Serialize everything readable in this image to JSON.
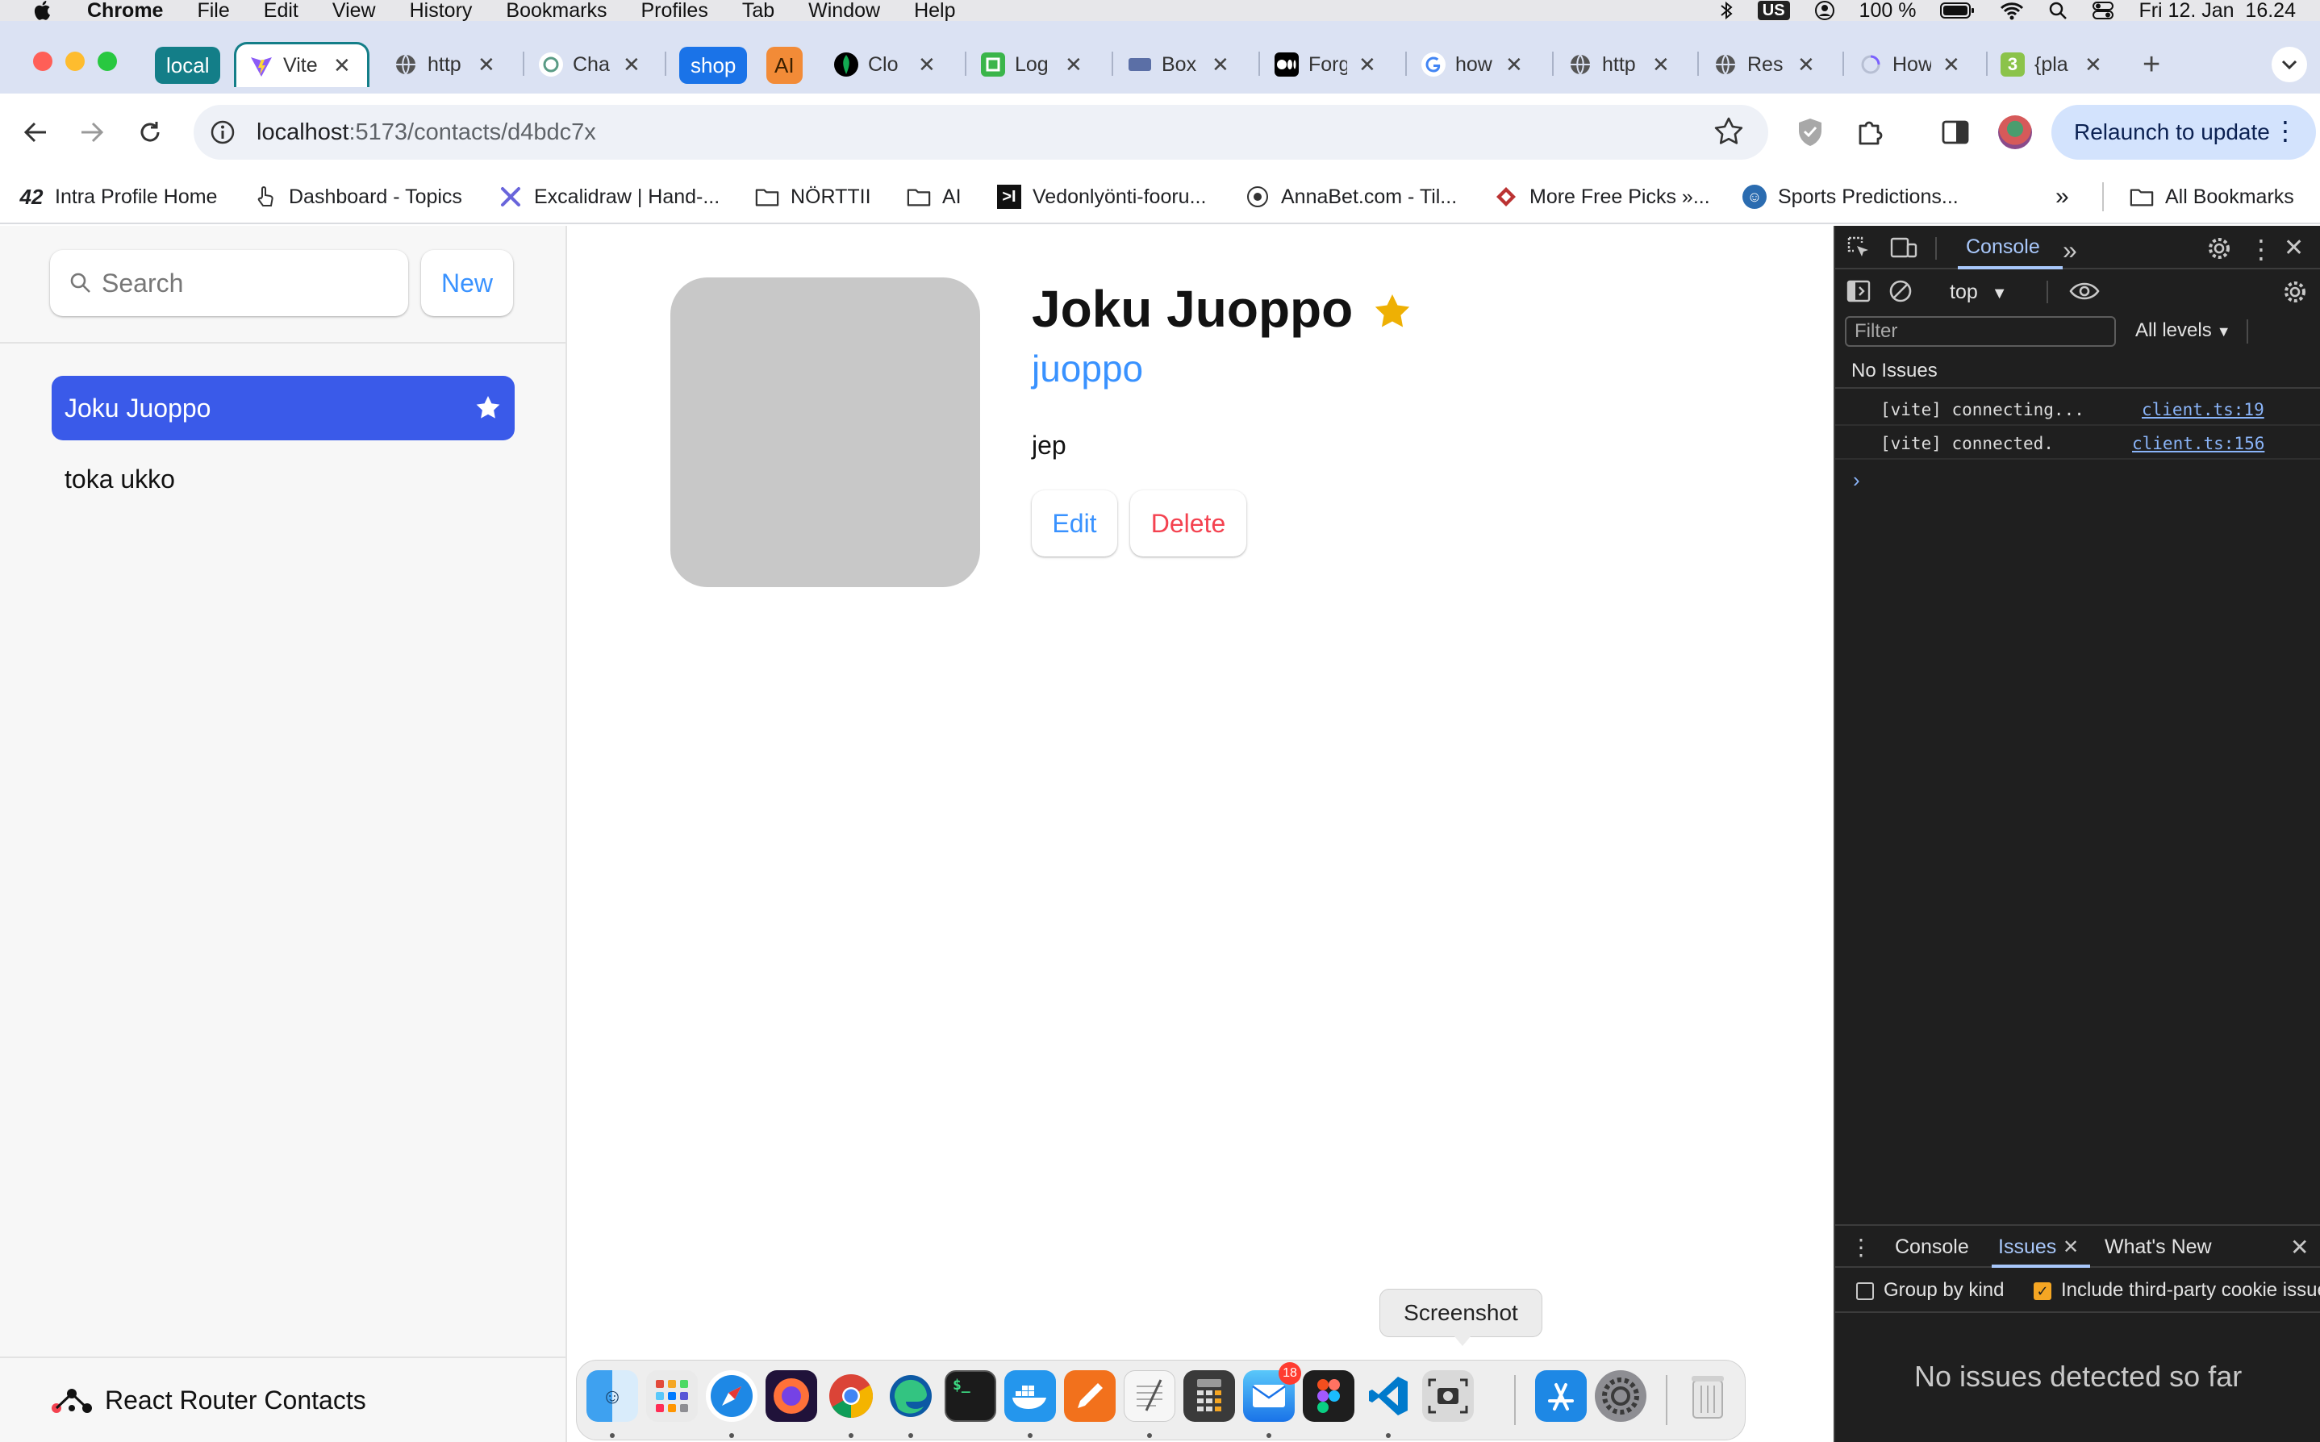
{
  "menubar": {
    "app_name": "Chrome",
    "items": [
      "File",
      "Edit",
      "View",
      "History",
      "Bookmarks",
      "Profiles",
      "Tab",
      "Window",
      "Help"
    ],
    "input_source": "US",
    "battery": "100 %",
    "datetime": "Fri 12. Jan  16.24"
  },
  "tabs": {
    "group_local": "local",
    "group_shop": "shop",
    "group_ai": "AI",
    "items": [
      {
        "title": "Vite",
        "icon": "vite-icon"
      },
      {
        "title": "http",
        "icon": "globe-icon"
      },
      {
        "title": "Cha",
        "icon": "chatgpt-icon"
      },
      {
        "title": "Clo",
        "icon": "mongodb-icon"
      },
      {
        "title": "Log",
        "icon": "log-icon"
      },
      {
        "title": "Box",
        "icon": "box-icon"
      },
      {
        "title": "Forg",
        "icon": "medium-icon"
      },
      {
        "title": "how",
        "icon": "google-icon"
      },
      {
        "title": "http",
        "icon": "globe-icon"
      },
      {
        "title": "Res",
        "icon": "globe-icon"
      },
      {
        "title": "How",
        "icon": "spinner-icon"
      },
      {
        "title": "{pla",
        "icon": "code-icon"
      }
    ]
  },
  "toolbar": {
    "url_host": "localhost",
    "url_rest": ":5173/contacts/d4bdc7x",
    "relaunch_label": "Relaunch to update"
  },
  "bookmarks": {
    "items": [
      "Intra Profile Home",
      "Dashboard - Topics",
      "Excalidraw | Hand-...",
      "NÖRTTII",
      "AI",
      "Vedonlyönti-fooru...",
      "AnnaBet.com - Til...",
      "More Free Picks »...",
      "Sports Predictions..."
    ],
    "all_bookmarks": "All Bookmarks"
  },
  "sidebar": {
    "search_placeholder": "Search",
    "new_label": "New",
    "contacts": [
      {
        "name": "Joku Juoppo",
        "favorite": true
      },
      {
        "name": "toka ukko",
        "favorite": false
      }
    ],
    "footer": "React Router Contacts"
  },
  "contact": {
    "name": "Joku Juoppo",
    "twitter": "juoppo",
    "notes": "jep",
    "edit_label": "Edit",
    "delete_label": "Delete"
  },
  "devtools": {
    "tab_console": "Console",
    "context": "top",
    "filter_placeholder": "Filter",
    "levels": "All levels",
    "issues_summary": "No Issues",
    "logs": [
      {
        "text": "[vite] connecting...",
        "source": "client.ts:19"
      },
      {
        "text": "[vite] connected.",
        "source": "client.ts:156"
      }
    ],
    "drawer_tabs": [
      "Console",
      "Issues",
      "What's New"
    ],
    "group_by_kind": "Group by kind",
    "third_party": "Include third-party cookie issue",
    "no_issues": "No issues detected so far"
  },
  "dock": {
    "tooltip": "Screenshot",
    "mail_badge": "18"
  },
  "colors": {
    "accent": "#3a5ae9",
    "link": "#3992ff",
    "danger": "#f44250",
    "favorite_star": "#eeb004"
  }
}
